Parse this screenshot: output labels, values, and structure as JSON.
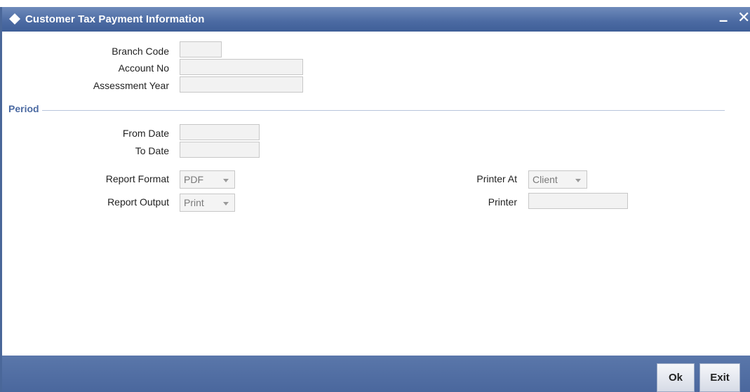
{
  "window": {
    "title": "Customer Tax Payment Information",
    "minimize_label": "–",
    "close_label": "✕"
  },
  "fields": {
    "branch_code": {
      "label": "Branch Code",
      "value": ""
    },
    "account_no": {
      "label": "Account No",
      "value": ""
    },
    "assessment_year": {
      "label": "Assessment Year",
      "value": ""
    }
  },
  "period": {
    "title": "Period",
    "from_date": {
      "label": "From Date",
      "value": ""
    },
    "to_date": {
      "label": "To Date",
      "value": ""
    }
  },
  "report": {
    "format": {
      "label": "Report Format",
      "selected": "PDF"
    },
    "output": {
      "label": "Report Output",
      "selected": "Print"
    },
    "printer_at": {
      "label": "Printer At",
      "selected": "Client"
    },
    "printer": {
      "label": "Printer",
      "value": ""
    }
  },
  "footer": {
    "ok_label": "Ok",
    "exit_label": "Exit"
  },
  "colors": {
    "titlebar": "#4b6aa2",
    "section_title": "#4b6aa2",
    "footer": "#4a679d"
  }
}
